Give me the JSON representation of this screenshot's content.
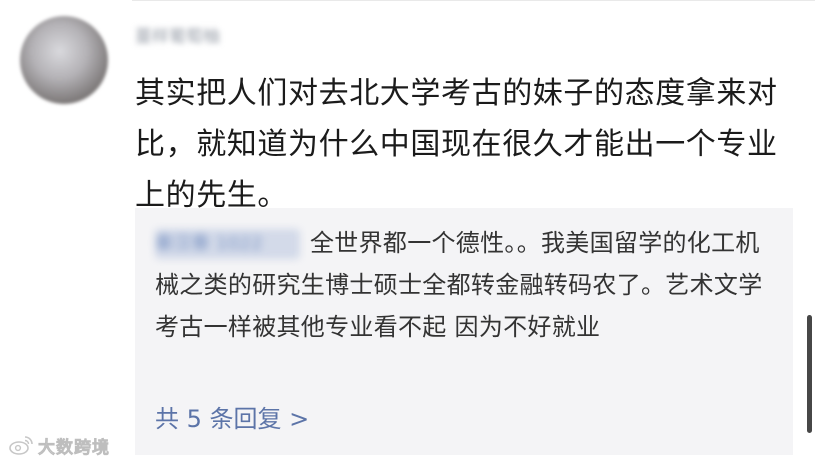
{
  "comment": {
    "username": "蔓样葡萄柚",
    "text": "其实把人们对去北大学考古的妹子的态度拿来对比，就知道为什么中国现在很久才能出一个专业上的先生。"
  },
  "reply": {
    "username": "秦汉春 1022",
    "text": "全世界都一个德性。。我美国留学的化工机械之类的研究生博士硕士全都转金融转码农了。艺术文学考古一样被其他专业看不起 因为不好就业",
    "more_label": "共 5 条回复 >"
  },
  "watermark": {
    "text": "大数跨境"
  },
  "colors": {
    "link": "#5c74a8",
    "reply_bg": "#f4f4f6",
    "body_text": "#1b1b1b"
  }
}
